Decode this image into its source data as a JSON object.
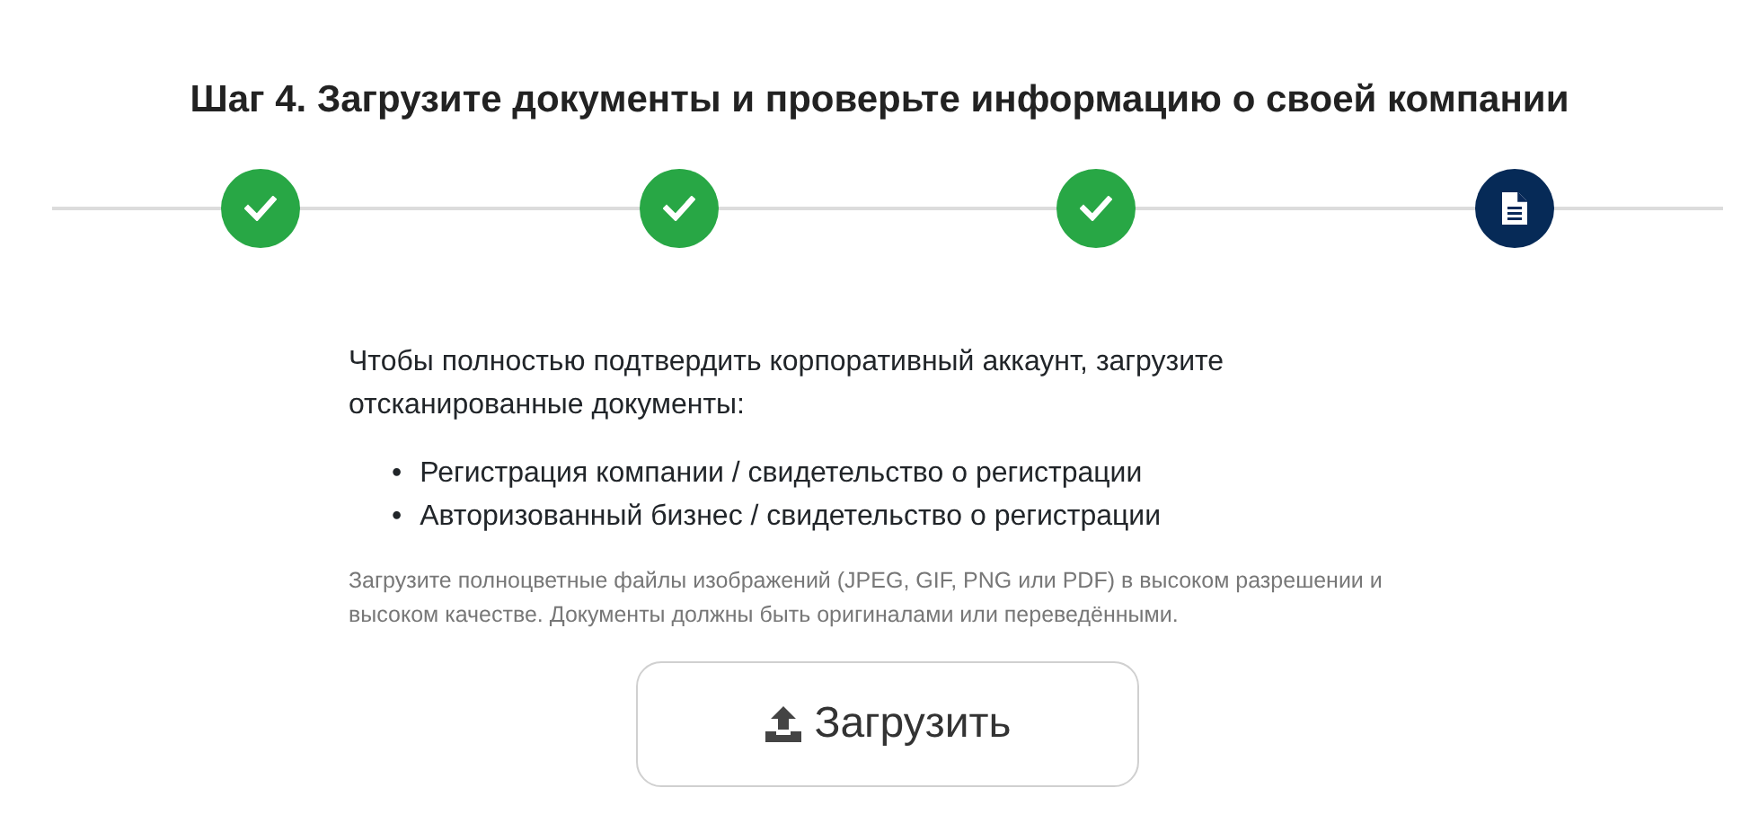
{
  "title": "Шаг 4. Загрузите документы и проверьте информацию о своей компании",
  "steps": [
    {
      "completed": true
    },
    {
      "completed": true
    },
    {
      "completed": true
    },
    {
      "completed": false
    }
  ],
  "intro": "Чтобы полностью подтвердить корпоративный аккаунт, загрузите отсканированные документы:",
  "documents": [
    {
      "bullet": "•",
      "text": "Регистрация компании / свидетельство о регистрации"
    },
    {
      "bullet": "•",
      "text": "Авторизованный бизнес / свидетельство о регистрации"
    }
  ],
  "note": "Загрузите полноцветные файлы изображений (JPEG, GIF, PNG или PDF) в высоком разрешении и высоком качестве. Документы должны быть оригиналами или переведёнными.",
  "upload_button": "Загрузить"
}
